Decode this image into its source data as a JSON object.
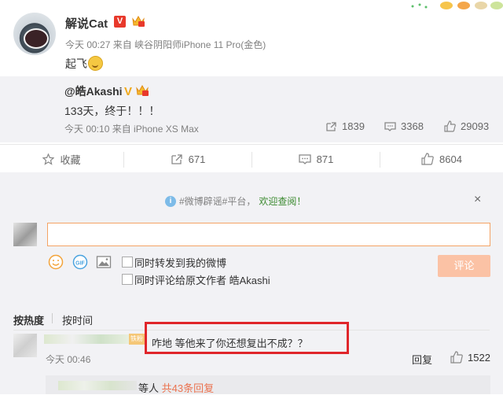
{
  "post": {
    "author": "解说Cat",
    "v_badge": "V",
    "meta": "今天 00:27 来自 峡谷阴阳师iPhone 11 Pro(金色)",
    "text": "起飞"
  },
  "repost": {
    "author": "@皓Akashi",
    "v_badge": "V",
    "text": "133天，终于！！！",
    "meta": "今天 00:10 来自 iPhone XS Max",
    "forward_count": "1839",
    "comment_count": "3368",
    "like_count": "29093"
  },
  "actions": {
    "favorite": "收藏",
    "forward": "671",
    "comment": "871",
    "like": "8604"
  },
  "comment_panel": {
    "notice_prefix": "#微博辟谣#平台，",
    "notice_link": "欢迎查阅！",
    "close": "×",
    "input_value": "",
    "option_forward": "同时转发到我的微博",
    "option_comment_origin": "同时评论给原文作者 皓Akashi",
    "submit": "评论"
  },
  "sort": {
    "by_hot": "按热度",
    "by_time": "按时间"
  },
  "comment": {
    "badge": "铁粉",
    "text": "咋地 等他来了你还想复出不成？？",
    "time": "今天 00:46",
    "reply": "回复",
    "likes": "1522",
    "sub_suffix": "等人",
    "sub_link": "共43条回复"
  },
  "colors": {
    "accent_orange": "#eb7350",
    "highlight_box": "#e0262b",
    "panel_bg": "#f2f2f5"
  }
}
